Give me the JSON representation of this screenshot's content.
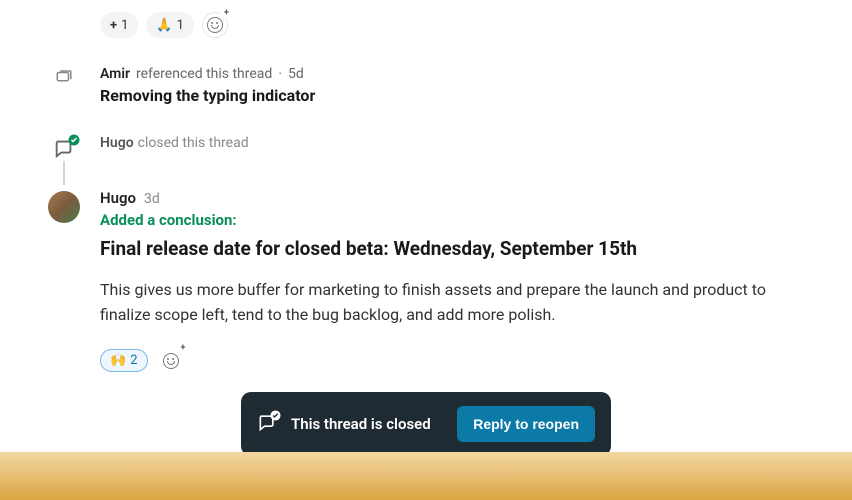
{
  "top_reactions": [
    {
      "emoji": "+",
      "count": "1"
    },
    {
      "emoji": "🙏",
      "count": "1"
    }
  ],
  "reference_event": {
    "author": "Amir",
    "action": "referenced this thread",
    "sep": "·",
    "time": "5d",
    "title": "Removing the typing indicator"
  },
  "closed_event": {
    "author": "Hugo",
    "action": "closed this thread"
  },
  "conclusion_post": {
    "author": "Hugo",
    "time": "3d",
    "label": "Added a conclusion:",
    "title": "Final release date for closed beta: Wednesday, September 15th",
    "body": "This gives us more buffer for marketing to finish assets and prepare the launch and product to finalize scope left, tend to the bug backlog, and add more polish.",
    "reaction_emoji": "🙌",
    "reaction_count": "2"
  },
  "closed_banner": {
    "text": "This thread is closed",
    "button": "Reply to reopen"
  }
}
